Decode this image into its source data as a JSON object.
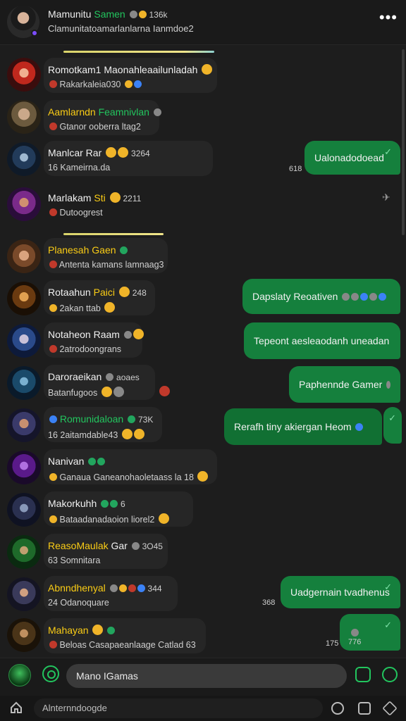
{
  "header": {
    "title_name": "Mamunitu",
    "title_highlight": "Samen",
    "title_count": "136k",
    "subtitle": "Clamunitatoamarlanlarna Ianmdoe2",
    "more_icon": "more-dots-icon",
    "colors": {
      "accent": "#22c55e",
      "online": "#7c4dff"
    }
  },
  "chats": [
    {
      "name": "Romotkam1 Maonahleaailunladah",
      "name_highlight": "",
      "meta": "",
      "preview": "Rakarkaleia030"
    },
    {
      "name": "",
      "name_highlight": "Aamlarndn",
      "name_highlight2": "Feamnivlan",
      "meta": "",
      "preview": "Gtanor ooberra ltag2"
    },
    {
      "name": "Manlcar Rar",
      "name_highlight": "",
      "meta": "3264",
      "preview": "16  Kameirna.da"
    },
    {
      "name": "Marlakam",
      "name_highlight": "Sti",
      "meta": "2211",
      "preview": "Dutoogrest"
    },
    {
      "name": "",
      "name_highlight": "Planesah Gaen",
      "meta": "",
      "preview": "Antenta kamans lamnaag3"
    },
    {
      "name": "Rotaahun",
      "name_highlight": "Paici",
      "meta": "248",
      "preview": "2akan ttab"
    },
    {
      "name": "Notaheon Raam",
      "name_highlight": "",
      "meta": "",
      "preview": "2atrodoongrans"
    },
    {
      "name": "Daroraeikan",
      "name_highlight": "",
      "meta": "aoaes",
      "preview": "Batanfugoos"
    },
    {
      "name": "",
      "name_highlight": "Romunidaloan",
      "meta": "73K",
      "preview": "16  2aitamdable43"
    },
    {
      "name": "Nanivan",
      "name_highlight": "",
      "meta": "",
      "preview": "Ganaua Ganeanohaoletaass la 18"
    },
    {
      "name": "Makorkuhh",
      "name_highlight": "",
      "meta": "6",
      "preview": "Bataadanadaoion liorel2"
    },
    {
      "name": "",
      "name_highlight": "ReasoMaulak",
      "name_highlight2": "Gar",
      "meta": "3O45",
      "preview": "63  Somnitara"
    },
    {
      "name": "",
      "name_highlight": "Abnndhenyal",
      "meta": "344",
      "preview": "24  Odanoquare"
    },
    {
      "name": "",
      "name_highlight": "Mahayan",
      "meta": "",
      "preview": "Beloas Casapaeanlaage Catlad 63"
    }
  ],
  "outgoing": [
    {
      "text": "Ualonadodoead",
      "time": "618"
    },
    {
      "text": "Dapslaty Reoativen",
      "time": ""
    },
    {
      "text": "Tepeont aesleaodanh uneadan",
      "time": ""
    },
    {
      "text": "Paphennde Gamer",
      "time": ""
    },
    {
      "text": "Rerafh tiny akiergan Heom",
      "time": ""
    },
    {
      "text": "Uadgernain tvadhenus",
      "time": "368"
    },
    {
      "text": "",
      "time": "175",
      "time2": "776"
    }
  ],
  "composer": {
    "placeholder": "Mano IGamas",
    "emoji_icon": "emoji-icon",
    "attach_icon": "attach-icon",
    "send_icon": "send-icon"
  },
  "bottombar": {
    "search_text": "Alnternndoogde",
    "home_icon": "home-icon"
  }
}
